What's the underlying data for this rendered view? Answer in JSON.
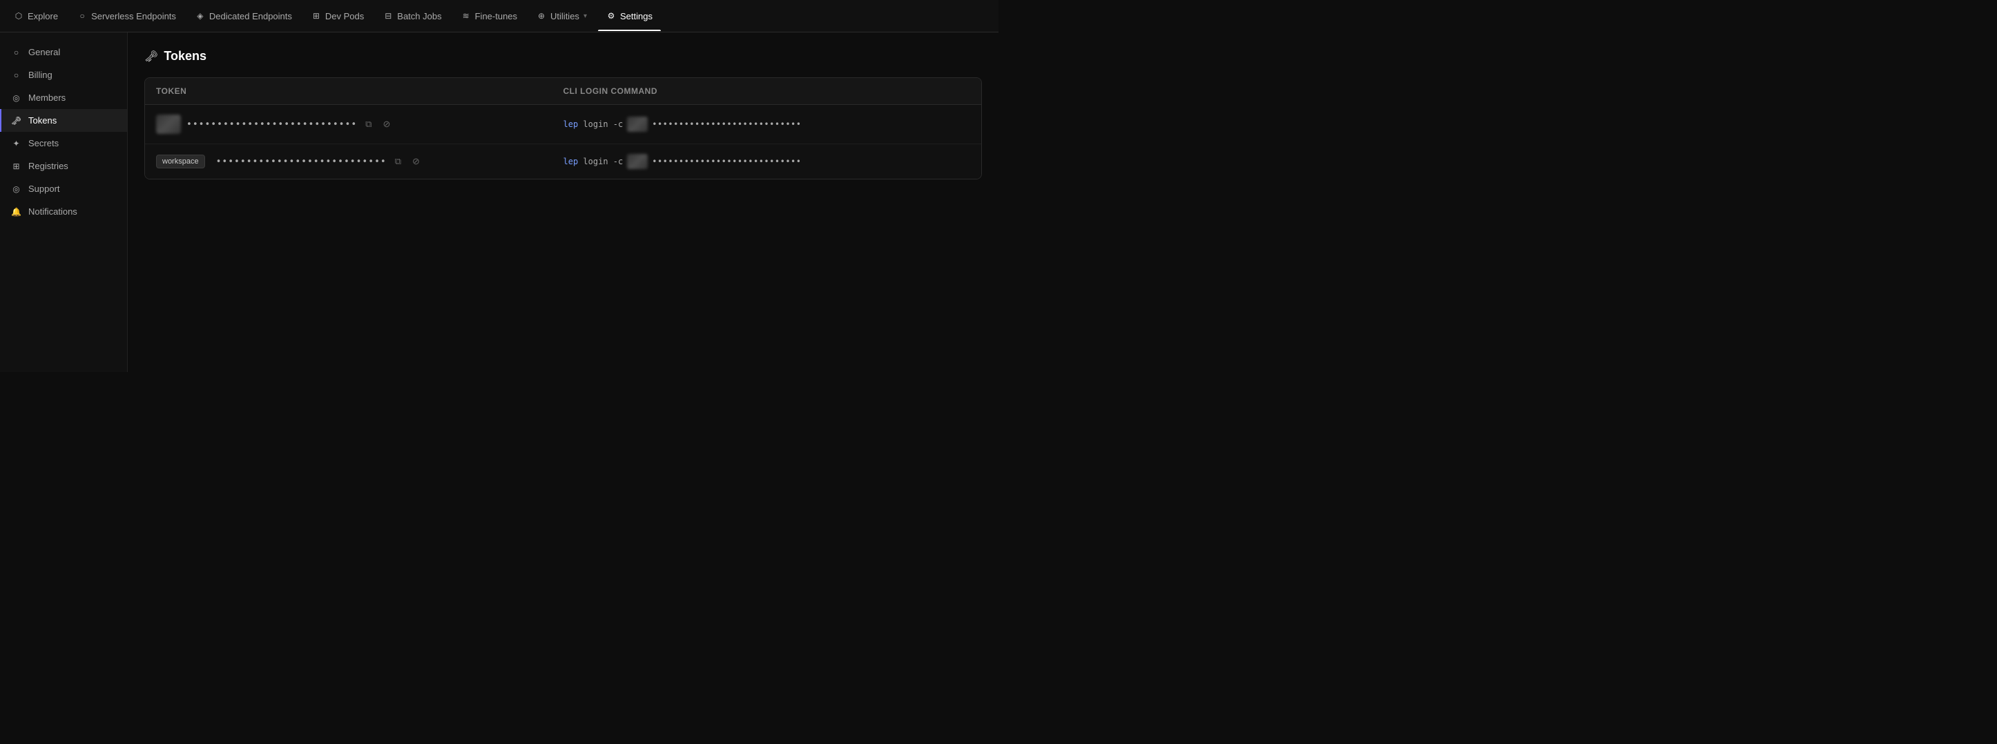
{
  "nav": {
    "items": [
      {
        "id": "explore",
        "label": "Explore",
        "icon": "⬡",
        "active": false
      },
      {
        "id": "serverless-endpoints",
        "label": "Serverless Endpoints",
        "icon": "○",
        "active": false
      },
      {
        "id": "dedicated-endpoints",
        "label": "Dedicated Endpoints",
        "icon": "◈",
        "active": false
      },
      {
        "id": "dev-pods",
        "label": "Dev Pods",
        "icon": "⊞",
        "active": false
      },
      {
        "id": "batch-jobs",
        "label": "Batch Jobs",
        "icon": "⊟",
        "active": false
      },
      {
        "id": "fine-tunes",
        "label": "Fine-tunes",
        "icon": "≋",
        "active": false
      },
      {
        "id": "utilities",
        "label": "Utilities",
        "icon": "⊕",
        "active": false,
        "hasDropdown": true
      },
      {
        "id": "settings",
        "label": "Settings",
        "icon": "⚙",
        "active": true
      }
    ]
  },
  "sidebar": {
    "items": [
      {
        "id": "general",
        "label": "General",
        "icon": "○",
        "active": false
      },
      {
        "id": "billing",
        "label": "Billing",
        "icon": "○",
        "active": false
      },
      {
        "id": "members",
        "label": "Members",
        "icon": "◎",
        "active": false
      },
      {
        "id": "tokens",
        "label": "Tokens",
        "icon": "🔑",
        "active": true
      },
      {
        "id": "secrets",
        "label": "Secrets",
        "icon": "✦",
        "active": false
      },
      {
        "id": "registries",
        "label": "Registries",
        "icon": "⊞",
        "active": false
      },
      {
        "id": "support",
        "label": "Support",
        "icon": "◎",
        "active": false
      },
      {
        "id": "notifications",
        "label": "Notifications",
        "icon": "🔔",
        "active": false
      }
    ]
  },
  "page": {
    "title": "Tokens",
    "icon": "🔑"
  },
  "table": {
    "headers": [
      "Token",
      "CLI login command"
    ],
    "rows": [
      {
        "hasAvatar": true,
        "hasBadge": false,
        "badgeLabel": "",
        "tokenMasked": "••••••••••••••••••••••••••••",
        "cliPrefix": "lep login -c",
        "cliMasked": "••••••••••••••••••••••••••••"
      },
      {
        "hasAvatar": false,
        "hasBadge": true,
        "badgeLabel": "workspace",
        "tokenMasked": "••••••••••••••••••••••••••••",
        "cliPrefix": "lep login -c",
        "cliMasked": "••••••••••••••••••••••••••••"
      }
    ]
  },
  "icons": {
    "copy": "⧉",
    "eye-slash": "⊘",
    "key": "🗝",
    "chevron-down": "▾"
  }
}
